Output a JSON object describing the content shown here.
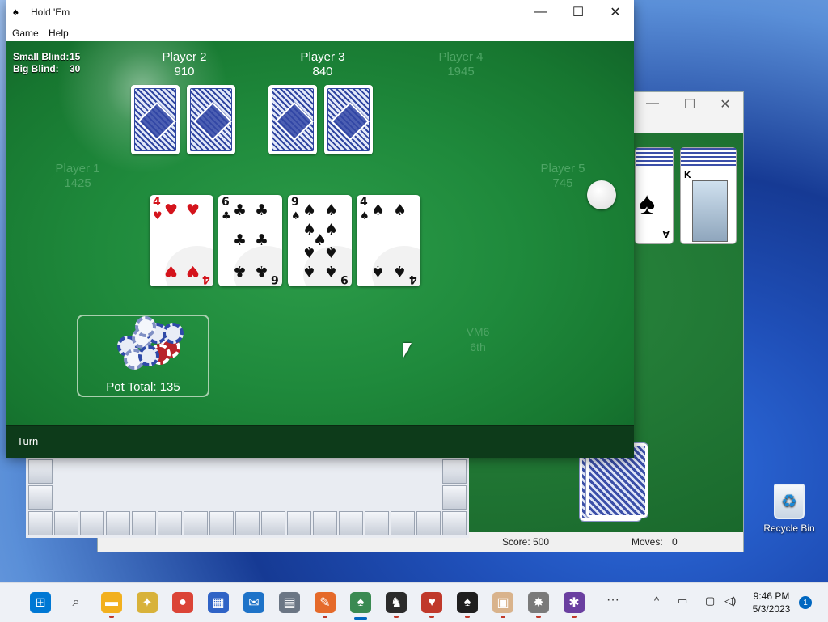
{
  "colors": {
    "felt": "#1f8a3c",
    "felt_dark": "#0d3b1a",
    "taskbar": "#eef1f6",
    "accent": "#0067c0"
  },
  "desktop": {
    "recycle_bin_label": "Recycle Bin",
    "recycle_bin_icon": "recycle-bin-icon"
  },
  "solitaire_window": {
    "status": {
      "score": "Score: 500",
      "moves_label": "Moves:",
      "moves_value": "0"
    },
    "controls": {
      "minimize": "—",
      "maximize": "☐",
      "close": "✕"
    },
    "cards": [
      {
        "rank": "A",
        "suit": "♠"
      },
      {
        "rank": "K",
        "suit": "♠"
      }
    ]
  },
  "holdem": {
    "title": "Hold 'Em",
    "window_controls": {
      "minimize": "—",
      "maximize": "☐",
      "close": "✕"
    },
    "menu": [
      "Game",
      "Help"
    ],
    "blinds": {
      "small_label": "Small Blind:",
      "small_value": "15",
      "big_label": "Big Blind:",
      "big_value": "30"
    },
    "players": [
      {
        "name": "Player 1",
        "chips": "1425",
        "state": "inactive"
      },
      {
        "name": "Player 2",
        "chips": "910",
        "state": "active"
      },
      {
        "name": "Player 3",
        "chips": "840",
        "state": "active"
      },
      {
        "name": "Player 4",
        "chips": "1945",
        "state": "inactive"
      },
      {
        "name": "Player 5",
        "chips": "745",
        "state": "inactive"
      },
      {
        "name": "VM6",
        "chips": "6th",
        "state": "inactive"
      }
    ],
    "community_cards": [
      {
        "rank": "4",
        "suit": "♥",
        "color": "red"
      },
      {
        "rank": "6",
        "suit": "♣",
        "color": "black"
      },
      {
        "rank": "9",
        "suit": "♠",
        "color": "black"
      },
      {
        "rank": "4",
        "suit": "♠",
        "color": "black"
      }
    ],
    "pot": {
      "label": "Pot Total: 135"
    },
    "round_label": "Turn"
  },
  "taskbar": {
    "apps": [
      {
        "name": "start-icon",
        "glyph": "⊞",
        "bg": "#0078d4",
        "indicator": "none"
      },
      {
        "name": "search-icon",
        "glyph": "⌕",
        "bg": "transparent",
        "indicator": "none"
      },
      {
        "name": "file-explorer-icon",
        "glyph": "▬",
        "bg": "#f2b01e",
        "indicator": "dot"
      },
      {
        "name": "spider-bee-icon",
        "glyph": "✦",
        "bg": "#d8b23a",
        "indicator": "none"
      },
      {
        "name": "chrome-icon",
        "glyph": "●",
        "bg": "#db4437",
        "indicator": "none"
      },
      {
        "name": "store-icon",
        "glyph": "▦",
        "bg": "#2f63c6",
        "indicator": "none"
      },
      {
        "name": "mail-icon",
        "glyph": "✉",
        "bg": "#1e73c8",
        "indicator": "none"
      },
      {
        "name": "calculator-icon",
        "glyph": "▤",
        "bg": "#6b7684",
        "indicator": "none"
      },
      {
        "name": "paint-icon",
        "glyph": "✎",
        "bg": "#e56a2a",
        "indicator": "dot"
      },
      {
        "name": "holdem-icon",
        "glyph": "♠",
        "bg": "#3a8a52",
        "indicator": "active"
      },
      {
        "name": "chess-icon",
        "glyph": "♞",
        "bg": "#2b2b2b",
        "indicator": "dot"
      },
      {
        "name": "hearts-icon",
        "glyph": "♥",
        "bg": "#c0392b",
        "indicator": "dot"
      },
      {
        "name": "spades-icon",
        "glyph": "♠",
        "bg": "#1f1f1f",
        "indicator": "dot"
      },
      {
        "name": "mahjong-icon",
        "glyph": "▣",
        "bg": "#d9b38c",
        "indicator": "dot"
      },
      {
        "name": "minesweeper-icon",
        "glyph": "✸",
        "bg": "#7a7a7a",
        "indicator": "dot"
      },
      {
        "name": "spider-solitaire-icon",
        "glyph": "✱",
        "bg": "#6a3fa0",
        "indicator": "dot"
      }
    ],
    "overflow_label": "···",
    "tray": {
      "chevron": "^",
      "time": "9:46 PM",
      "date": "5/3/2023",
      "notifications": "1"
    }
  }
}
